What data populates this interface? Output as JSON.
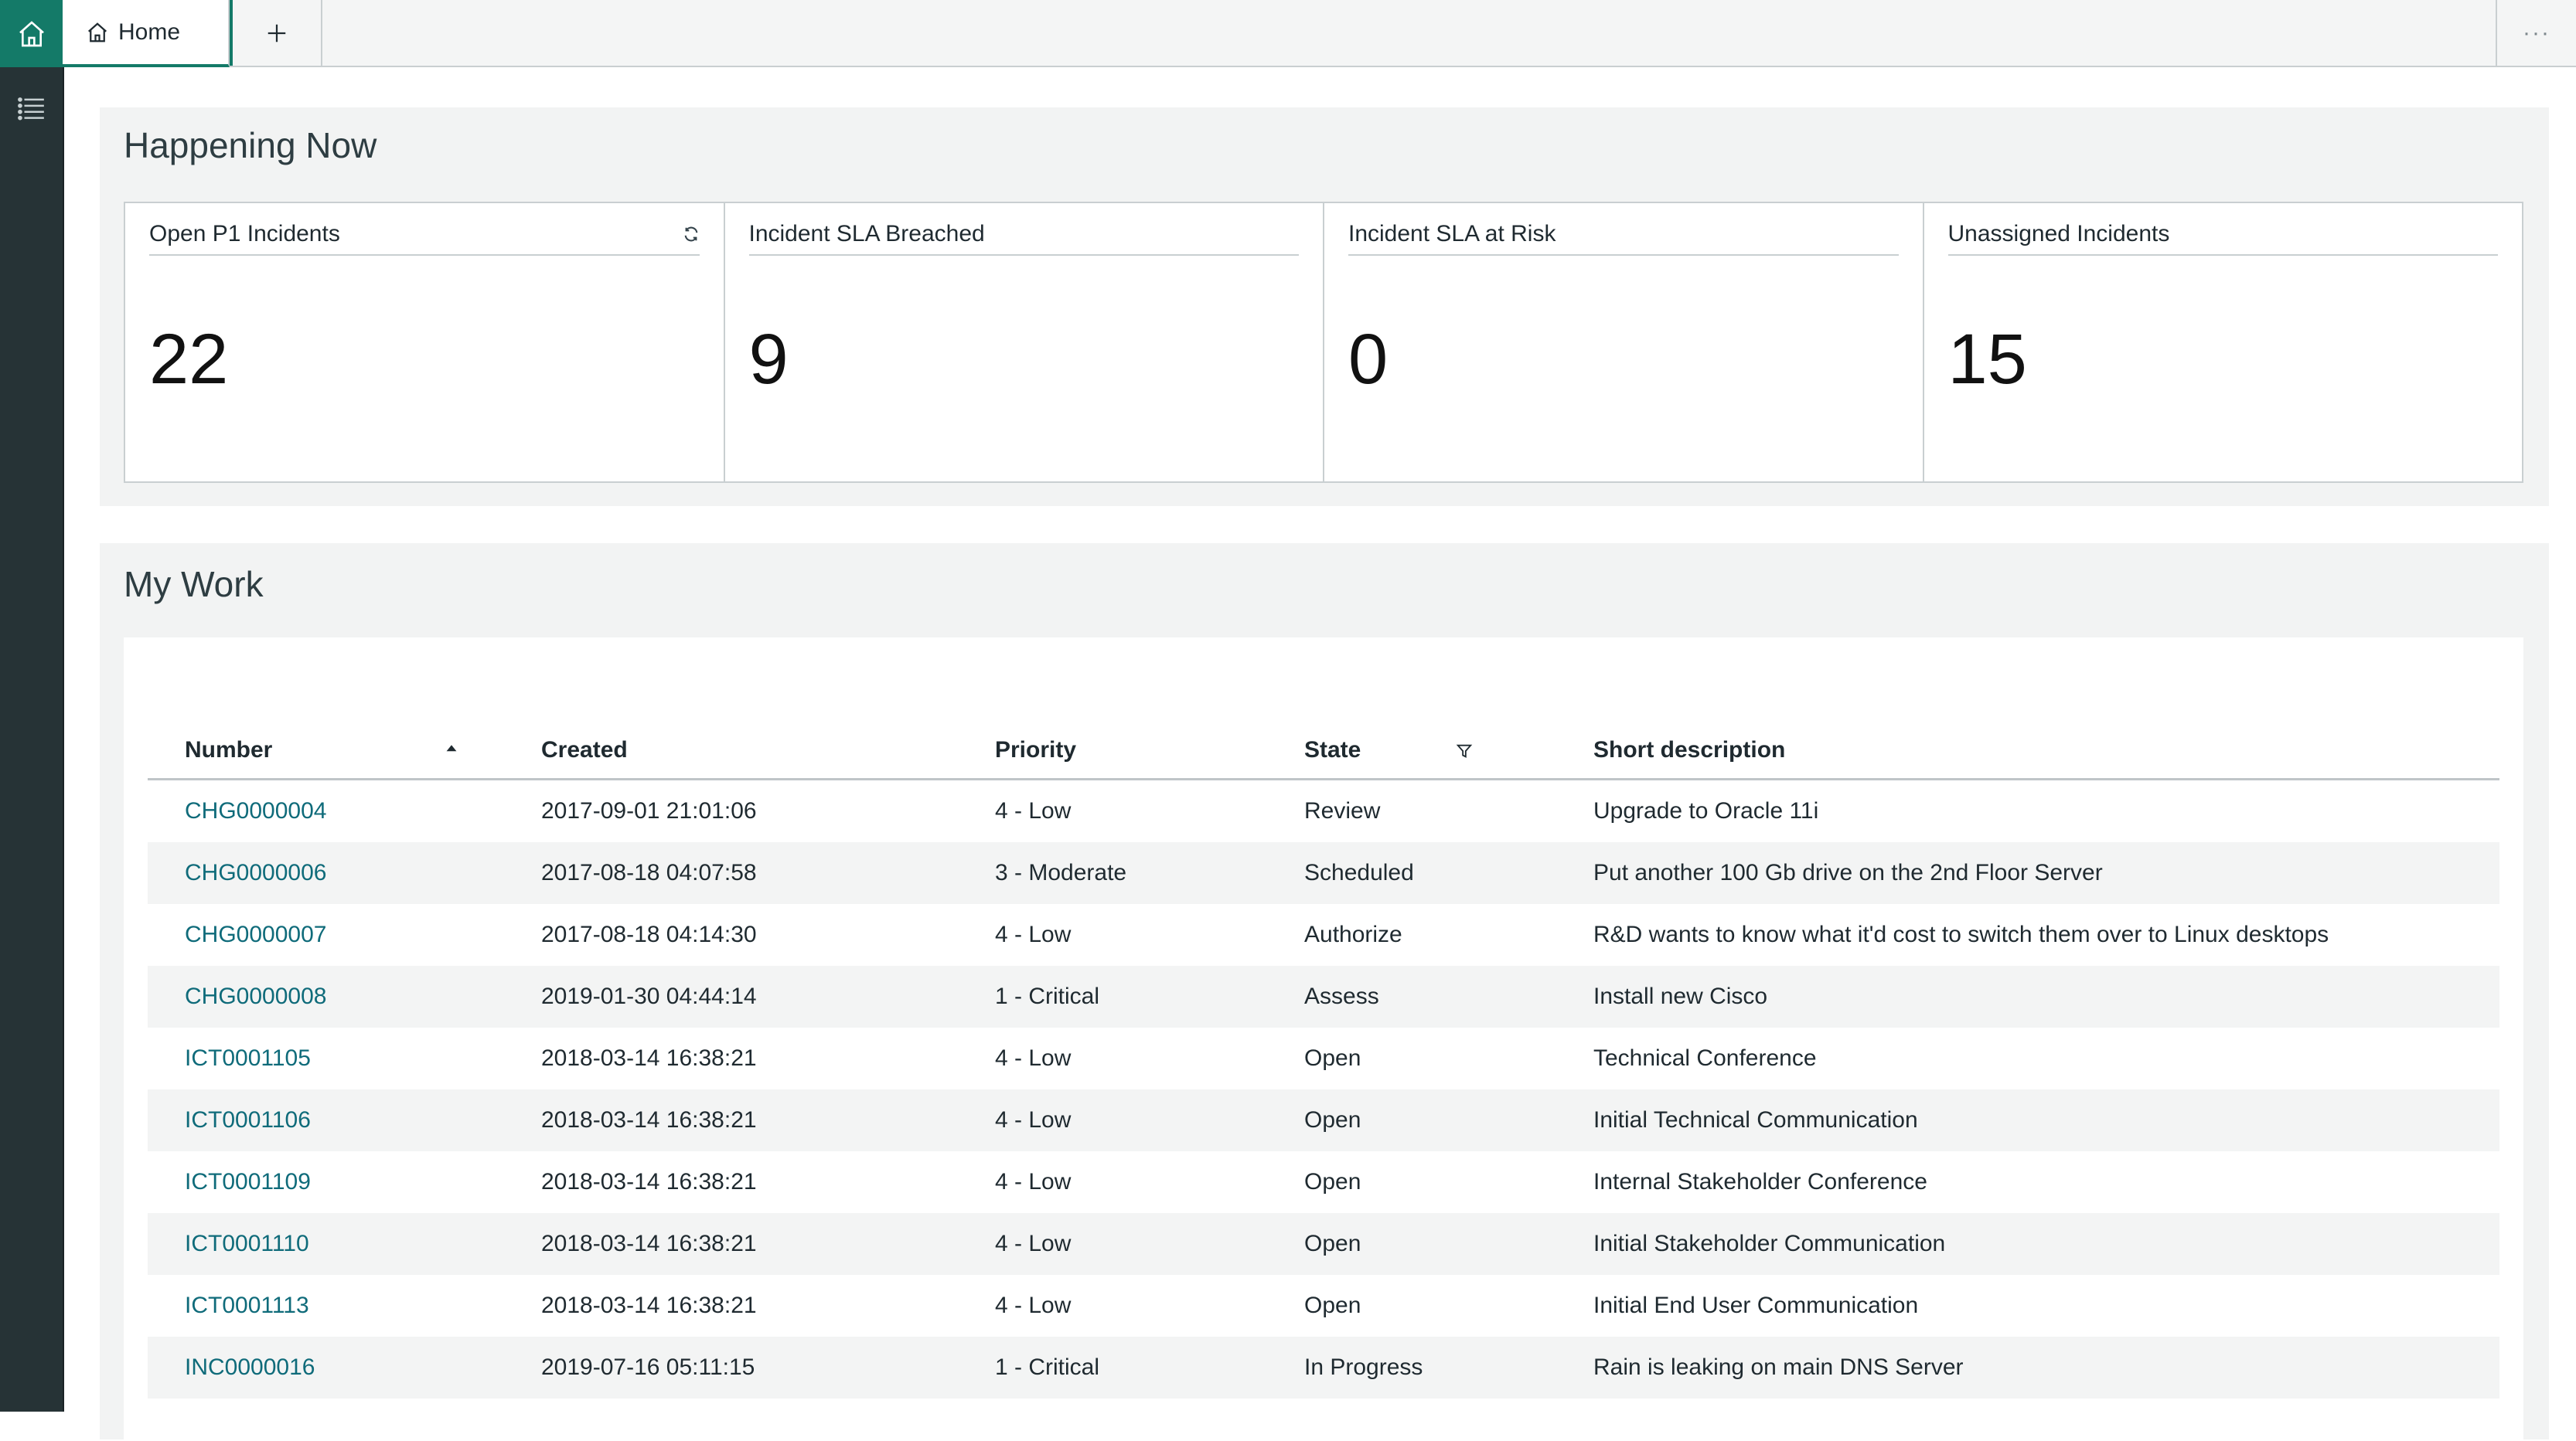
{
  "tabs": {
    "home_label": "Home"
  },
  "happening_now": {
    "title": "Happening Now",
    "cards": [
      {
        "label": "Open P1 Incidents",
        "value": "22"
      },
      {
        "label": "Incident SLA Breached",
        "value": "9"
      },
      {
        "label": "Incident SLA at Risk",
        "value": "0"
      },
      {
        "label": "Unassigned Incidents",
        "value": "15"
      }
    ]
  },
  "my_work": {
    "title": "My Work",
    "columns": [
      "Number",
      "Created",
      "Priority",
      "State",
      "Short description"
    ],
    "rows": [
      [
        "CHG0000004",
        "2017-09-01 21:01:06",
        "4 - Low",
        "Review",
        "Upgrade to Oracle 11i"
      ],
      [
        "CHG0000006",
        "2017-08-18 04:07:58",
        "3 - Moderate",
        "Scheduled",
        "Put another 100 Gb drive on the 2nd Floor Server"
      ],
      [
        "CHG0000007",
        "2017-08-18 04:14:30",
        "4 - Low",
        "Authorize",
        "R&D wants to know what it'd cost to switch them over to Linux desktops"
      ],
      [
        "CHG0000008",
        "2019-01-30 04:44:14",
        "1 - Critical",
        "Assess",
        "Install new Cisco"
      ],
      [
        "ICT0001105",
        "2018-03-14 16:38:21",
        "4 - Low",
        "Open",
        "Technical Conference"
      ],
      [
        "ICT0001106",
        "2018-03-14 16:38:21",
        "4 - Low",
        "Open",
        "Initial Technical Communication"
      ],
      [
        "ICT0001109",
        "2018-03-14 16:38:21",
        "4 - Low",
        "Open",
        "Internal Stakeholder Conference"
      ],
      [
        "ICT0001110",
        "2018-03-14 16:38:21",
        "4 - Low",
        "Open",
        "Initial Stakeholder Communication"
      ],
      [
        "ICT0001113",
        "2018-03-14 16:38:21",
        "4 - Low",
        "Open",
        "Initial End User Communication"
      ],
      [
        "INC0000016",
        "2019-07-16 05:11:15",
        "1 - Critical",
        "In Progress",
        "Rain is leaking on main DNS Server"
      ]
    ]
  },
  "colors": {
    "accent": "#147a68",
    "rail": "#263336",
    "link": "#0f6b7a"
  }
}
